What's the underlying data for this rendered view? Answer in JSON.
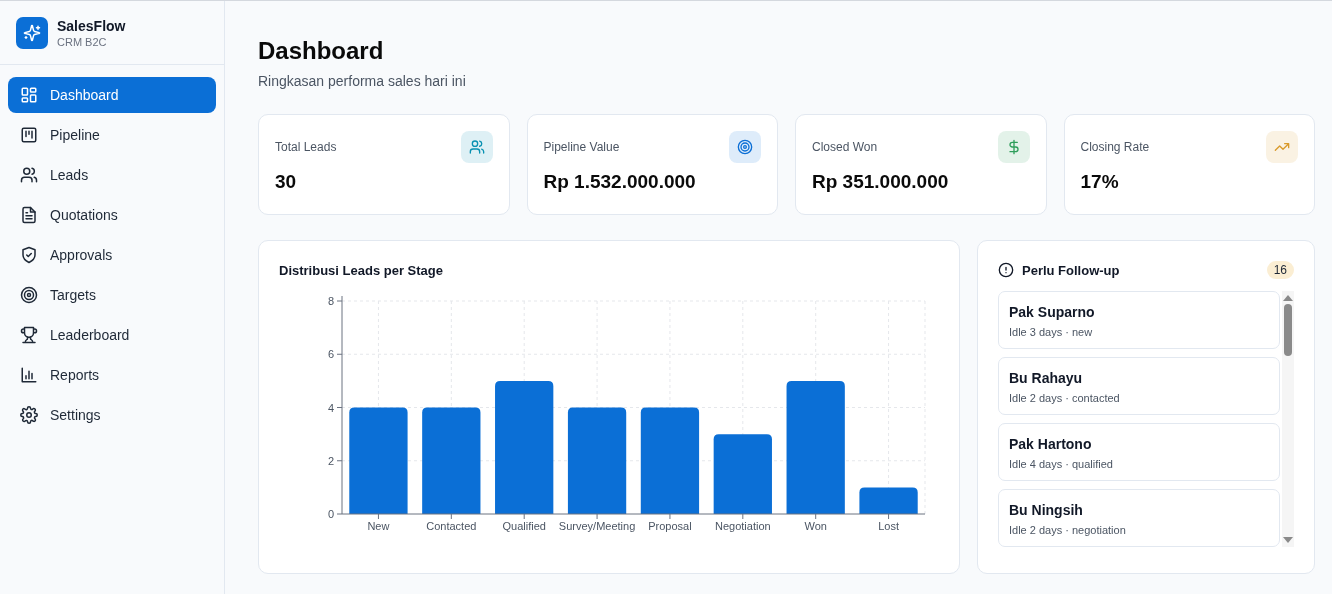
{
  "brand": {
    "name": "SalesFlow",
    "subtitle": "CRM B2C"
  },
  "sidebar": {
    "items": [
      {
        "label": "Dashboard",
        "selected": true
      },
      {
        "label": "Pipeline",
        "selected": false
      },
      {
        "label": "Leads",
        "selected": false
      },
      {
        "label": "Quotations",
        "selected": false
      },
      {
        "label": "Approvals",
        "selected": false
      },
      {
        "label": "Targets",
        "selected": false
      },
      {
        "label": "Leaderboard",
        "selected": false
      },
      {
        "label": "Reports",
        "selected": false
      },
      {
        "label": "Settings",
        "selected": false
      }
    ]
  },
  "page": {
    "title": "Dashboard",
    "subtitle": "Ringkasan performa sales hari ini"
  },
  "stats": [
    {
      "label": "Total Leads",
      "value": "30",
      "color": "#0891b2"
    },
    {
      "label": "Pipeline Value",
      "value": "Rp 1.532.000.000",
      "color": "#0b6fd6"
    },
    {
      "label": "Closed Won",
      "value": "Rp 351.000.000",
      "color": "#2f9e5b"
    },
    {
      "label": "Closing Rate",
      "value": "17%",
      "color": "#d99a2b"
    }
  ],
  "chart": {
    "title": "Distribusi Leads per Stage",
    "chart_data": {
      "type": "bar",
      "categories": [
        "New",
        "Contacted",
        "Qualified",
        "Survey/Meeting",
        "Proposal",
        "Negotiation",
        "Won",
        "Lost"
      ],
      "values": [
        4,
        4,
        5,
        4,
        4,
        3,
        5,
        1
      ],
      "grid": true,
      "ylim": [
        0,
        8
      ],
      "yticks": [
        0,
        2,
        4,
        6,
        8
      ]
    }
  },
  "followup": {
    "title": "Perlu Follow-up",
    "count": "16",
    "items": [
      {
        "name": "Pak Suparno",
        "detail": "Idle 3 days · new"
      },
      {
        "name": "Bu Rahayu",
        "detail": "Idle 2 days · contacted"
      },
      {
        "name": "Pak Hartono",
        "detail": "Idle 4 days · qualified"
      },
      {
        "name": "Bu Ningsih",
        "detail": "Idle 2 days · negotiation"
      }
    ]
  }
}
